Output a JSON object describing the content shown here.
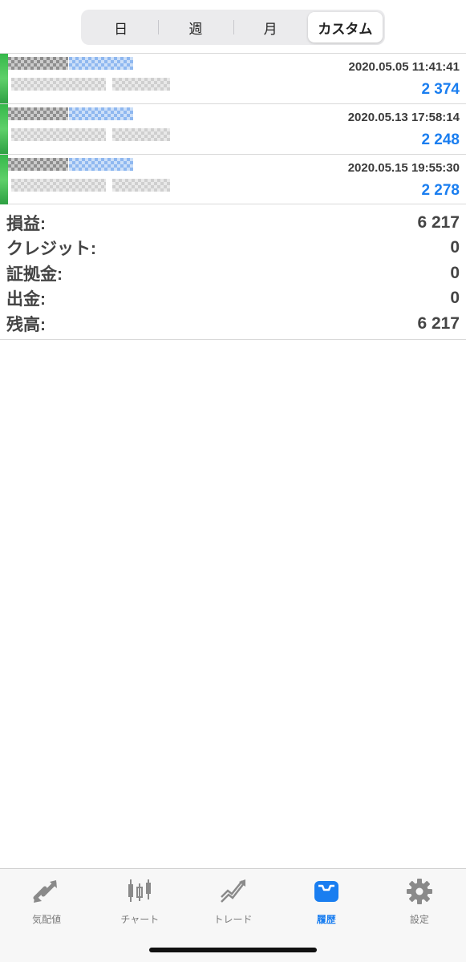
{
  "period_selector": {
    "options": [
      "日",
      "週",
      "月",
      "カスタム"
    ],
    "selected": "カスタム"
  },
  "deals": [
    {
      "time": "2020.05.05 11:41:41",
      "profit": "2 374"
    },
    {
      "time": "2020.05.13 17:58:14",
      "profit": "2 248"
    },
    {
      "time": "2020.05.15 19:55:30",
      "profit": "2 278"
    }
  ],
  "summary": [
    {
      "label": "損益:",
      "value": "6 217"
    },
    {
      "label": "クレジット:",
      "value": "0"
    },
    {
      "label": "証拠金:",
      "value": "0"
    },
    {
      "label": "出金:",
      "value": "0"
    },
    {
      "label": "残高:",
      "value": "6 217"
    }
  ],
  "tabbar": {
    "items": [
      {
        "label": "気配値",
        "icon": "quotes-icon"
      },
      {
        "label": "チャート",
        "icon": "chart-icon"
      },
      {
        "label": "トレード",
        "icon": "trade-icon"
      },
      {
        "label": "履歴",
        "icon": "history-icon"
      },
      {
        "label": "設定",
        "icon": "settings-icon"
      }
    ],
    "active": "履歴"
  },
  "colors": {
    "accent": "#1a7ef0",
    "profit_text": "#1a7ef0",
    "strip_green": "#35b84a"
  }
}
